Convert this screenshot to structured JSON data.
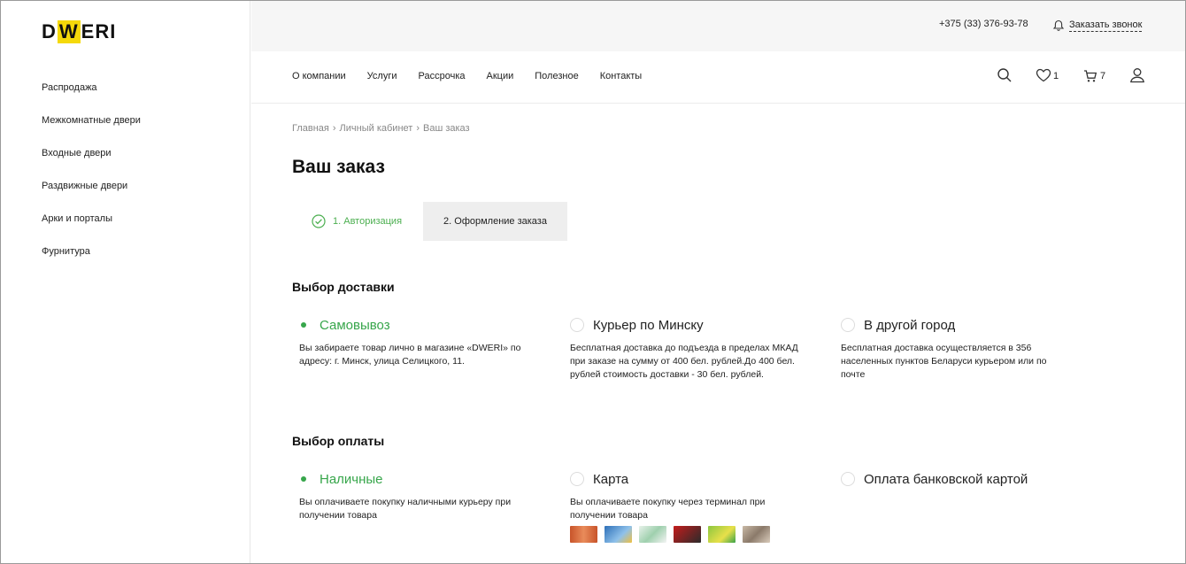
{
  "logo": {
    "pre": "D",
    "accent": "W",
    "post": "ERI"
  },
  "sidebar": {
    "items": [
      {
        "label": "Распродажа"
      },
      {
        "label": "Межкомнатные двери"
      },
      {
        "label": "Входные двери"
      },
      {
        "label": "Раздвижные двери"
      },
      {
        "label": "Арки и порталы"
      },
      {
        "label": "Фурнитура"
      }
    ]
  },
  "topbar": {
    "phone": "+375 (33) 376-93-78",
    "callback_label": "Заказать звонок",
    "bell_icon": "bell-icon"
  },
  "mainnav": {
    "links": [
      {
        "label": "О компании"
      },
      {
        "label": "Услуги"
      },
      {
        "label": "Рассрочка"
      },
      {
        "label": "Акции"
      },
      {
        "label": "Полезное"
      },
      {
        "label": "Контакты"
      }
    ],
    "favorites_count": "1",
    "cart_count": "7"
  },
  "breadcrumb": {
    "items": [
      "Главная",
      "Личный кабинет",
      "Ваш заказ"
    ],
    "separator": "›"
  },
  "page_title": "Ваш заказ",
  "steps": {
    "step1": "1. Авторизация",
    "step2": "2. Оформление заказа"
  },
  "delivery": {
    "title": "Выбор доставки",
    "options": [
      {
        "label": "Самовывоз",
        "selected": true,
        "desc": "Вы забираете товар лично в магазине «DWERI» по адресу: г. Минск, улица Селицкого, 11."
      },
      {
        "label": "Курьер по Минску",
        "selected": false,
        "desc": "Бесплатная доставка до подъезда в пределах МКАД при заказе на сумму от 400 бел. рублей.До 400 бел. рублей стоимость доставки - 30 бел. рублей."
      },
      {
        "label": "В другой город",
        "selected": false,
        "desc": "Бесплатная доставка осуществляется в 356 населенных пунктов Беларуси курьером или по почте"
      }
    ]
  },
  "payment": {
    "title": "Выбор оплаты",
    "options": [
      {
        "label": "Наличные",
        "selected": true,
        "desc": "Вы оплачиваете покупку наличными курьеру при получении товара"
      },
      {
        "label": "Карта",
        "selected": false,
        "desc": "Вы оплачиваете покупку через терминал при получении товара"
      },
      {
        "label": "Оплата банковской картой",
        "selected": false,
        "desc": ""
      }
    ],
    "card_icons": [
      "card-icon-1",
      "card-icon-2",
      "card-icon-3",
      "card-icon-4",
      "card-icon-5",
      "card-icon-6"
    ]
  },
  "colors": {
    "accent_green": "#37a64b",
    "logo_yellow": "#f5d90a"
  }
}
